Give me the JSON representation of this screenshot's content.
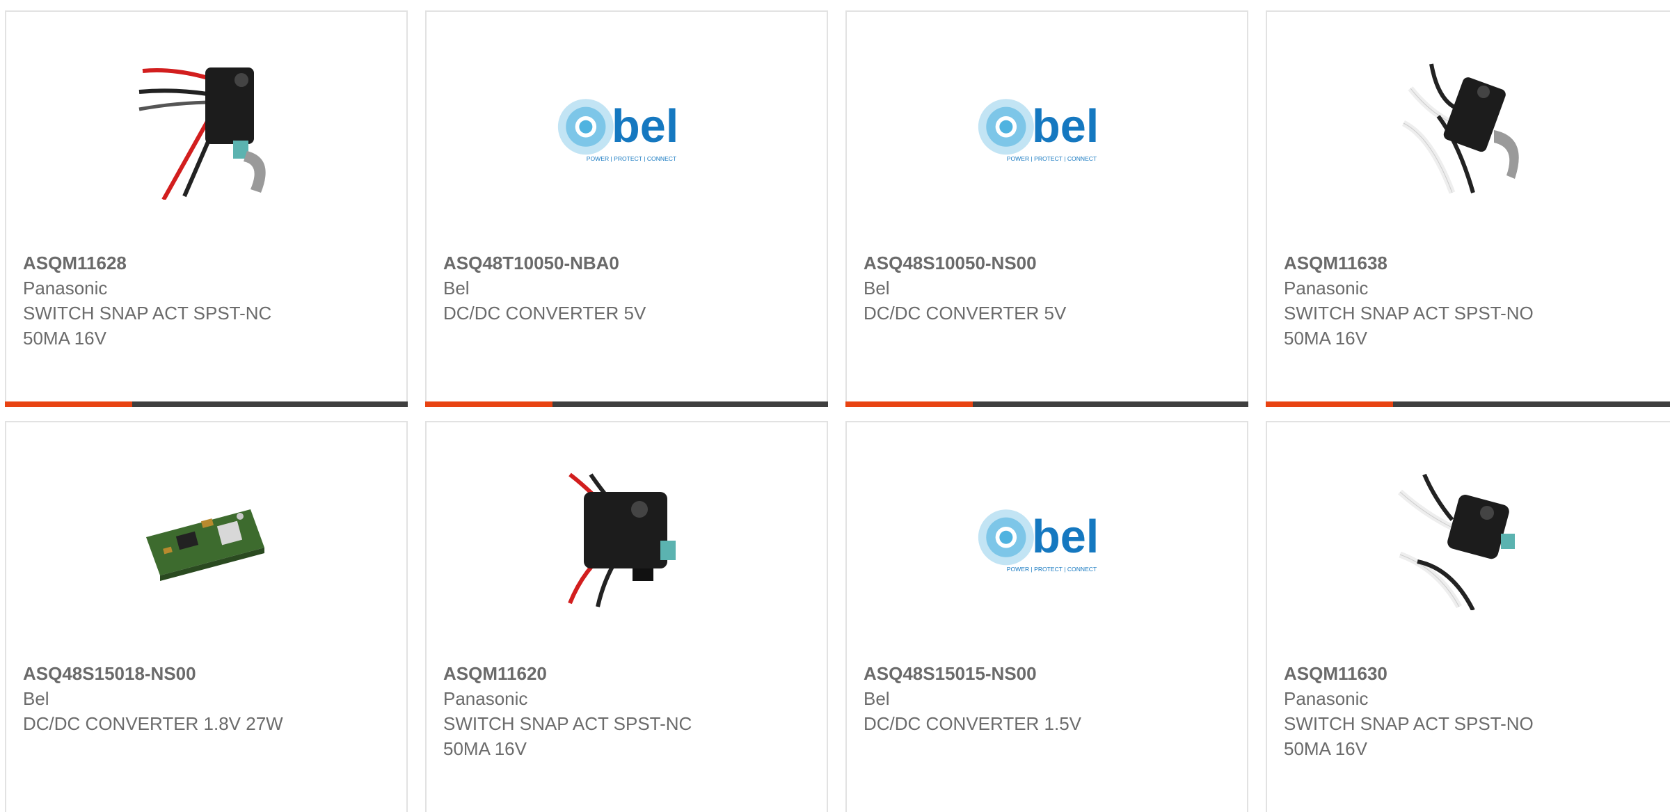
{
  "products": [
    {
      "part_number": "ASQM11628",
      "manufacturer": "Panasonic",
      "description": "SWITCH SNAP ACT SPST-NC 50MA 16V",
      "image": "snap-switch-red-wires-icon"
    },
    {
      "part_number": "ASQ48T10050-NBA0",
      "manufacturer": "Bel",
      "description": "DC/DC CONVERTER 5V",
      "image": "bel-logo"
    },
    {
      "part_number": "ASQ48S10050-NS00",
      "manufacturer": "Bel",
      "description": "DC/DC CONVERTER 5V",
      "image": "bel-logo"
    },
    {
      "part_number": "ASQM11638",
      "manufacturer": "Panasonic",
      "description": "SWITCH SNAP ACT SPST-NO 50MA 16V",
      "image": "snap-switch-white-wires-icon"
    },
    {
      "part_number": "ASQ48S15018-NS00",
      "manufacturer": "Bel",
      "description": "DC/DC CONVERTER 1.8V 27W",
      "image": "converter-board-icon"
    },
    {
      "part_number": "ASQM11620",
      "manufacturer": "Panasonic",
      "description": "SWITCH SNAP ACT SPST-NC 50MA 16V",
      "image": "snap-switch-red-wires-icon"
    },
    {
      "part_number": "ASQ48S15015-NS00",
      "manufacturer": "Bel",
      "description": "DC/DC CONVERTER 1.5V",
      "image": "bel-logo"
    },
    {
      "part_number": "ASQM11630",
      "manufacturer": "Panasonic",
      "description": "SWITCH SNAP ACT SPST-NO 50MA 16V",
      "image": "snap-switch-white-wires-icon"
    }
  ],
  "bel_logo": {
    "wordmark": "bel",
    "tagline": "POWER | PROTECT | CONNECT"
  },
  "colors": {
    "accent": "#e84312",
    "bar_dark": "#3f3f3f",
    "bel_blue": "#1578c0",
    "bel_light": "#4fb3e0",
    "text": "#6b6b6b"
  }
}
